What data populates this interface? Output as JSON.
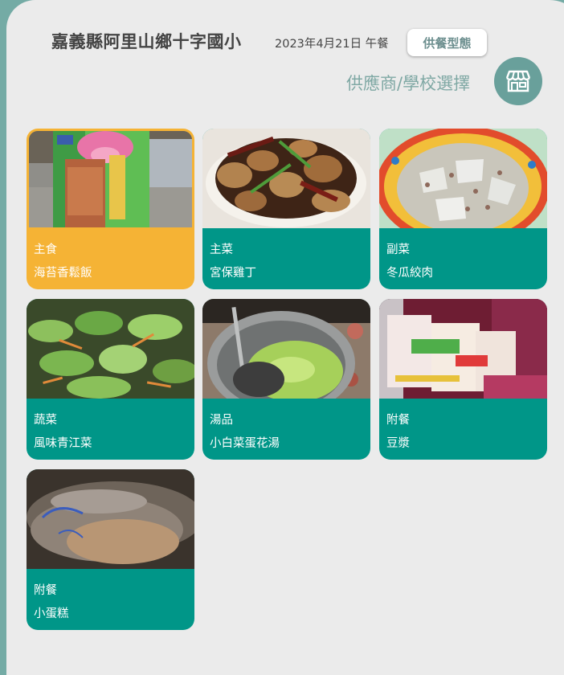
{
  "header": {
    "school_name": "嘉義縣阿里山鄉十字國小",
    "date_meal": "2023年4月21日 午餐",
    "meal_type_button": "供餐型態",
    "supplier_label": "供應商/學校選擇",
    "store_icon": "store-icon"
  },
  "dishes": [
    {
      "category": "主食",
      "name": "海苔香鬆飯",
      "selected": true
    },
    {
      "category": "主菜",
      "name": "宮保雞丁"
    },
    {
      "category": "副菜",
      "name": "冬瓜絞肉"
    },
    {
      "category": "蔬菜",
      "name": "風味青江菜"
    },
    {
      "category": "湯品",
      "name": "小白菜蛋花湯"
    },
    {
      "category": "附餐",
      "name": "豆漿"
    },
    {
      "category": "附餐",
      "name": "小蛋糕"
    }
  ],
  "colors": {
    "card_default": "#009688",
    "card_selected": "#f5b335",
    "background": "#ebebeb",
    "accent_teal": "#69a09b"
  }
}
